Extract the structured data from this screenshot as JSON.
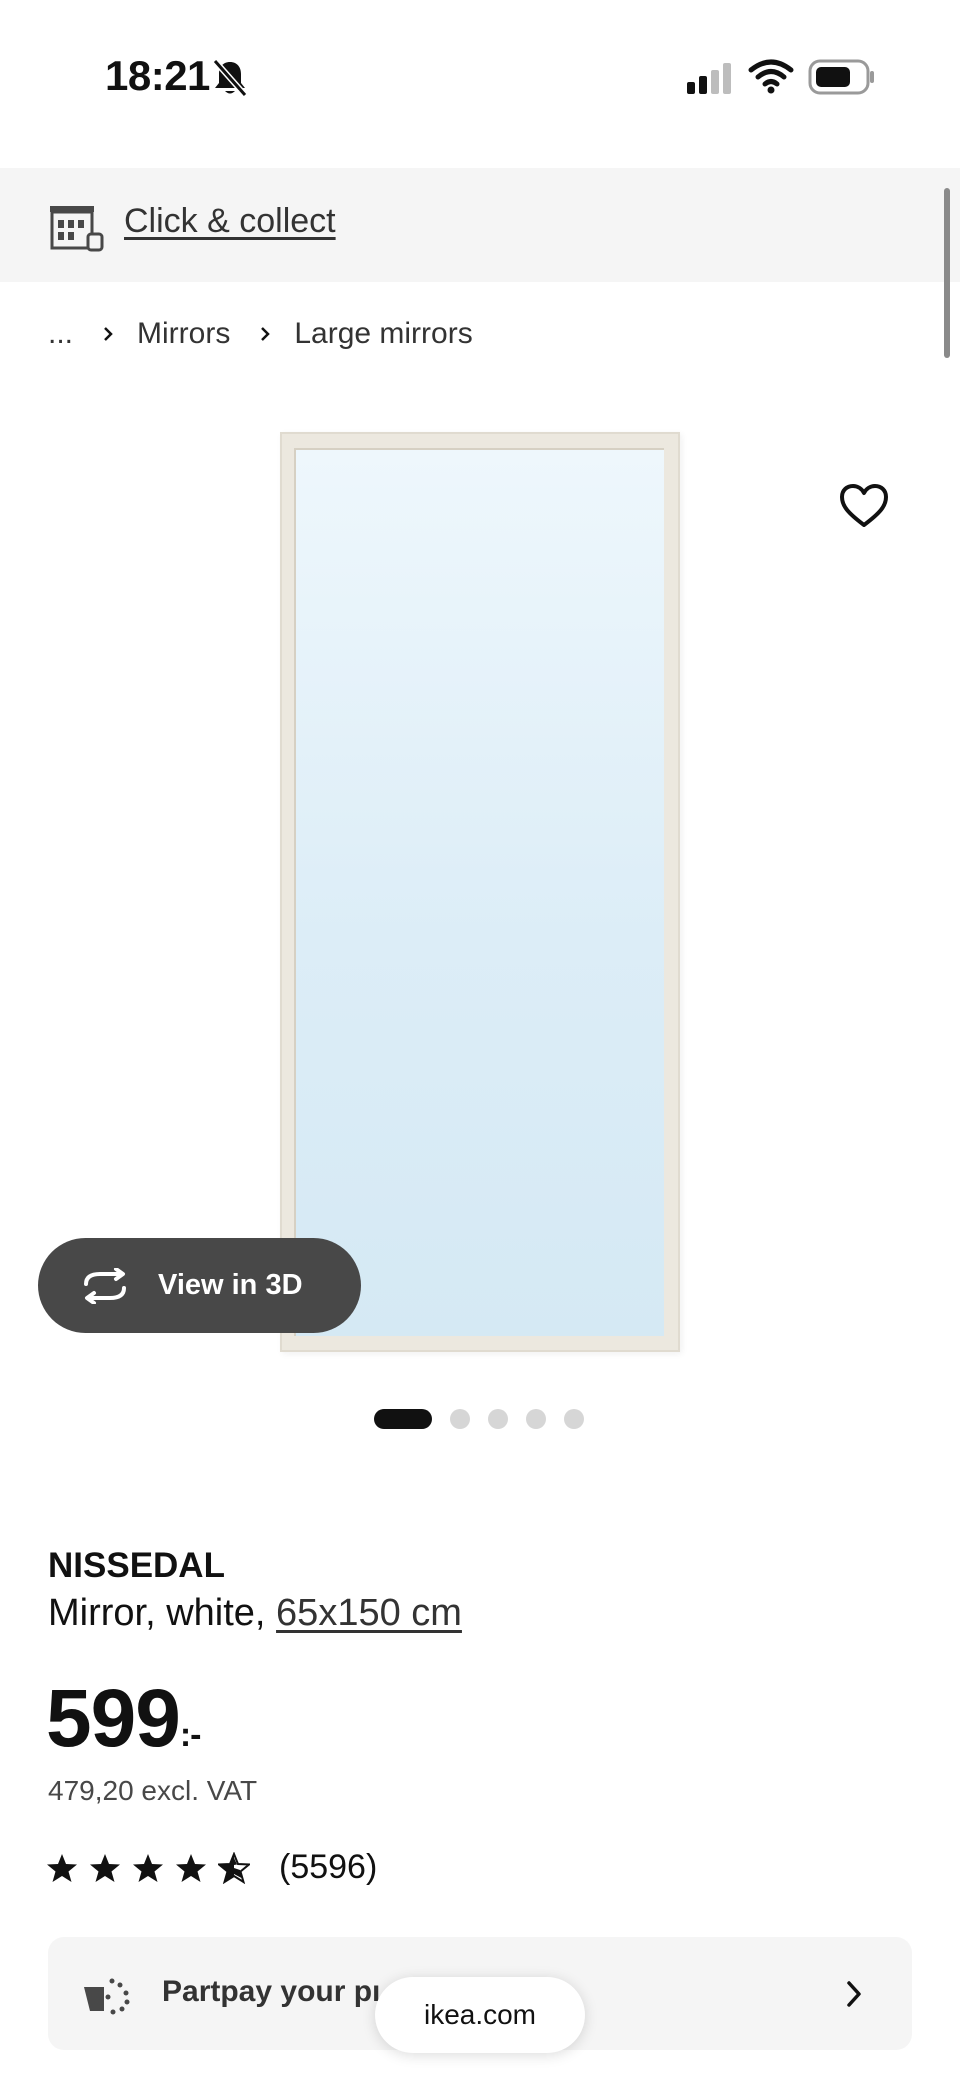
{
  "status_bar": {
    "time": "18:21",
    "icons": [
      "bell-slash-icon",
      "cellular-signal-icon",
      "wifi-icon",
      "battery-icon"
    ]
  },
  "collect_bar": {
    "icon": "store-icon",
    "label": "Click & collect"
  },
  "breadcrumb": {
    "items": [
      "...",
      "Mirrors",
      "Large mirrors"
    ],
    "separator_icon": "chevron-right-icon"
  },
  "gallery": {
    "favorite_icon": "heart-outline-icon",
    "view_3d_label": "View in 3D",
    "view_3d_icon": "rotate-3d-icon",
    "slide_count": 5,
    "active_slide": 1
  },
  "product": {
    "name": "NISSEDAL",
    "description": "Mirror, white, ",
    "size_link": "65x150 cm",
    "price": "599",
    "price_suffix": ":-",
    "price_excl_vat": "479,20 excl. VAT",
    "rating_stars": 4.5,
    "rating_max": 5,
    "review_count": "(5596)"
  },
  "partpay": {
    "icon": "partpay-icon",
    "label": "Partpay your pı",
    "chevron_icon": "chevron-right-icon"
  },
  "browser": {
    "url": "ikea.com"
  },
  "colors": {
    "bar_background": "#f5f5f5",
    "view_3d_background": "#484848",
    "mirror_glass": "#dcedf7",
    "mirror_frame": "#ece8df",
    "dot_active": "#111111",
    "dot_inactive": "#d6d6d6"
  }
}
